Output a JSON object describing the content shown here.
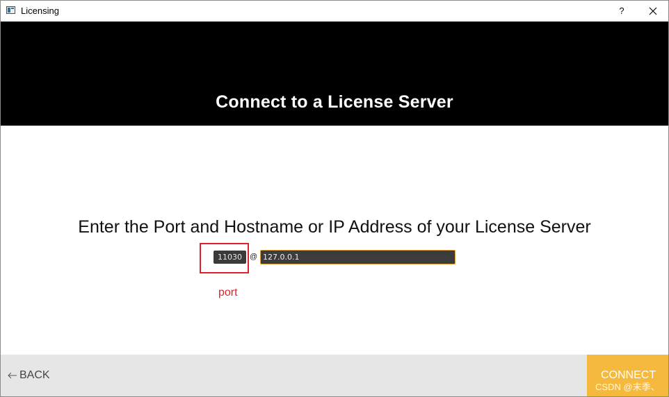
{
  "window": {
    "title": "Licensing",
    "help_label": "?"
  },
  "banner": {
    "title": "Connect to a License Server"
  },
  "form": {
    "instruction": "Enter the Port and Hostname or IP Address of your License Server",
    "port_value": "11030",
    "separator": "@",
    "host_value": "127.0.0.1"
  },
  "annotation": {
    "label": "port",
    "color": "#e0202a"
  },
  "footer": {
    "back_label": "BACK",
    "connect_label": "CONNECT",
    "watermark": "CSDN @末季、"
  },
  "colors": {
    "banner_bg": "#000000",
    "accent": "#f4b93d",
    "footer_bg": "#e6e6e6",
    "input_bg": "#3a3a3a"
  }
}
